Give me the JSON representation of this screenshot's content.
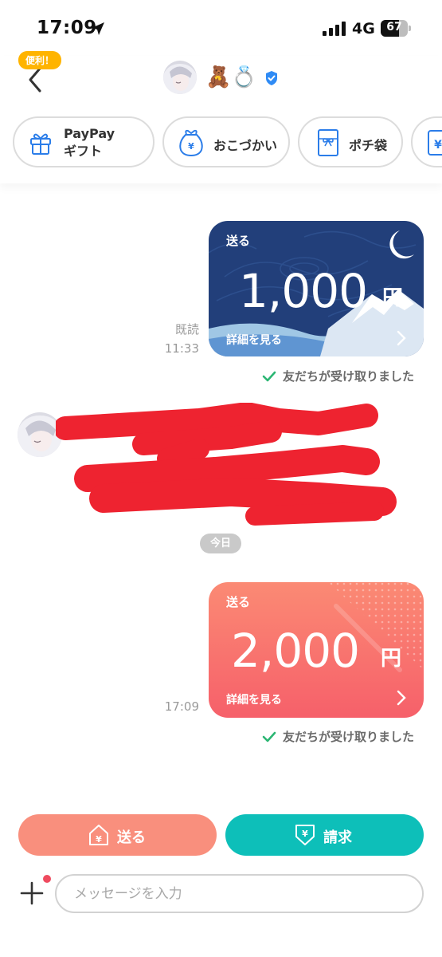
{
  "status_bar": {
    "time": "17:09",
    "network": "4G",
    "battery": "67",
    "battery_level": 0.67
  },
  "header": {
    "friend_name": "🧸💍",
    "icons": [
      "back-chevron-icon",
      "avatar",
      "verified-icon"
    ]
  },
  "quick_actions": {
    "badge": "便利！",
    "items": [
      {
        "label_line1": "PayPay",
        "label_line2": "ギフト",
        "icon": "gift-icon"
      },
      {
        "label": "おこづかい",
        "icon": "yen-pouch-icon"
      },
      {
        "label": "ポチ袋",
        "icon": "envelope-bow-icon"
      },
      {
        "label": "",
        "icon": "yen-card-icon"
      }
    ]
  },
  "messages": [
    {
      "type": "send",
      "label": "送る",
      "amount": "1,000",
      "unit": "円",
      "detail": "詳細を見る",
      "read": "既読",
      "time": "11:33",
      "status": "友だちが受け取りました",
      "theme": "night-mountain"
    },
    {
      "type": "redacted-text"
    },
    {
      "type": "date",
      "label": "今日"
    },
    {
      "type": "send",
      "label": "送る",
      "amount": "2,000",
      "unit": "円",
      "detail": "詳細を見る",
      "time": "17:09",
      "status": "友だちが受け取りました",
      "theme": "coral"
    }
  ],
  "actions": {
    "send_label": "送る",
    "request_label": "請求"
  },
  "composer": {
    "placeholder": "メッセージを入力"
  },
  "colors": {
    "send_button": "#f98f7d",
    "request_button": "#0dbfb9",
    "card_navy": "#223f7a",
    "card_coral": "#f6606a",
    "check_green": "#2bb673",
    "badge_yellow": "#ffb400",
    "redaction_red": "#ee2330"
  }
}
